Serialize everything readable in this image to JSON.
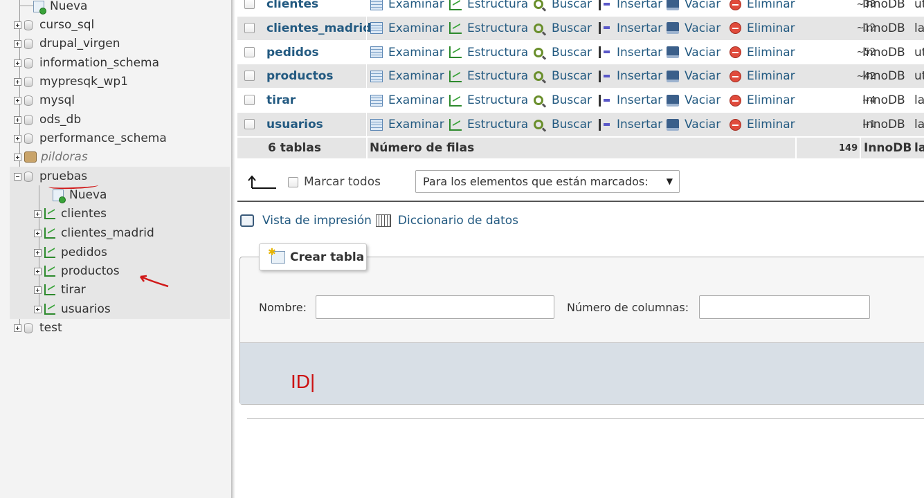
{
  "nav": {
    "top_new": "Nueva",
    "databases": [
      "curso_sql",
      "drupal_virgen",
      "information_schema",
      "mypresqk_wp1",
      "mysql",
      "ods_db",
      "performance_schema"
    ],
    "pildoras": "pildoras",
    "pruebas": "pruebas",
    "pruebas_children": {
      "new": "Nueva",
      "tables": [
        "clientes",
        "clientes_madrid",
        "pedidos",
        "productos",
        "tirar",
        "usuarios"
      ]
    },
    "test": "test",
    "annotation_color": "#d01818"
  },
  "table": {
    "actions": {
      "browse": "Examinar",
      "structure": "Estructura",
      "search": "Buscar",
      "insert": "Insertar",
      "empty": "Vaciar",
      "drop": "Eliminar"
    },
    "rows": [
      {
        "name": "clientes",
        "rows": "~38",
        "engine": "InnoDB",
        "collation": "ut"
      },
      {
        "name": "clientes_madrid",
        "rows": "~12",
        "engine": "InnoDB",
        "collation": "la"
      },
      {
        "name": "pedidos",
        "rows": "~52",
        "engine": "InnoDB",
        "collation": "ut"
      },
      {
        "name": "productos",
        "rows": "~42",
        "engine": "InnoDB",
        "collation": "ut"
      },
      {
        "name": "tirar",
        "rows": "~4",
        "engine": "InnoDB",
        "collation": "la"
      },
      {
        "name": "usuarios",
        "rows": "~1",
        "engine": "InnoDB",
        "collation": "la"
      }
    ],
    "summary": {
      "count": "6 tablas",
      "label": "Número de filas",
      "total_rows": "149",
      "engine": "InnoDB",
      "collation": "la"
    }
  },
  "bulk": {
    "mark_all": "Marcar todos",
    "select_value": "Para los elementos que están marcados:"
  },
  "links": {
    "print_view": "Vista de impresión",
    "data_dictionary": "Diccionario de datos"
  },
  "create_table": {
    "legend": "Crear tabla",
    "name_label": "Nombre:",
    "columns_label": "Número de columnas:",
    "name_value": "",
    "columns_value": "",
    "overlay_text": "ID|"
  },
  "colors": {
    "link": "#235a81",
    "row_alt": "#e5e5e5",
    "footer": "#d8dfe6"
  }
}
